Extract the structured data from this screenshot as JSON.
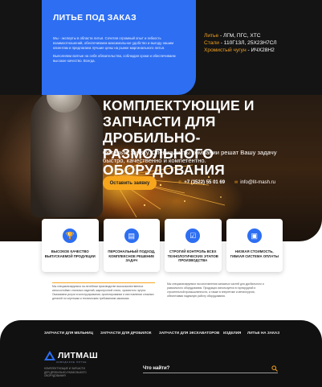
{
  "info_card": {
    "title": "ЛИТЬЕ ПОД ЗАКАЗ",
    "paragraph_1": "Мы - эксперты в области литья. Сочетая огромный опыт и гибкость взаимоотношений, обеспечиваем максимальное удобство и выгоду нашим клиентам и предлагаем лучшие цены на рынке маргинального литья.",
    "paragraph_2": "Выполняем взятые на себя обязательства, соблюдая сроки и обеспечиваем высокое качество. Всегда."
  },
  "materials": [
    {
      "label": "Литье",
      "value": " - ЛГМ, ПГС, ХТС"
    },
    {
      "label": "Стали",
      "value": " - 110Г13Л, 25Х23Н7СЛ"
    },
    {
      "label": "Хромистый чугун",
      "value": " - ИЧХ28Н2"
    }
  ],
  "hero": {
    "headline": "КОМПЛЕКТУЮЩИЕ И ЗАПЧАСТИ ДЛЯ ДРОБИЛЬНО-РАЗМОЛЬНОГО ОБОРУДОВАНИЯ",
    "lead": "Оставьте заявку. Специалисты компании решат Вашу задачу быстро, качественно и компетентно.",
    "cta_label": "Оставить заявку",
    "phone": "+7 (3522) 55 01 69",
    "email": "info@lit-mash.ru"
  },
  "features": [
    {
      "icon": "trophy-icon",
      "label": "ВЫСОКОЕ КАЧЕСТВО ВЫПУСКАЕМОЙ ПРОДУКЦИИ"
    },
    {
      "icon": "document-icon",
      "label": "ПЕРСОНАЛЬНЫЙ ПОДХОД, КОМПЛЕКСНОЕ РЕШЕНИЕ ЗАДАЧ"
    },
    {
      "icon": "clipboard-icon",
      "label": "СТРОГИЙ КОНТРОЛЬ ВСЕХ ТЕХНОЛОГИЧЕСКИХ ЭТАПОВ ПРОИЗВОДСТВА"
    },
    {
      "icon": "wallet-icon",
      "label": "НИЗКАЯ СТОИМОСТЬ, ГИБКАЯ СИСТЕМА ОПЛАТЫ"
    }
  ],
  "descriptions": {
    "left": "Мы специализируемся на литейном производстве высококачественных износостойких стальных изделий, жаропрочной стали, хромистого чугуна. Оказываем услуги в конструировании, проектировании и изготовлении сложных деталей по чертежам и техническим требованиям заказчика.",
    "right": "Мы специализируемся на изготовлении запасных частей для дробильного и размольного оборудования. Продукция используется в горнорудной и строительной промышленности, а также в энергетике и металлургии, обеспечивая надежную работу оборудования."
  },
  "footer": {
    "nav": [
      "ЗАПЧАСТИ ДЛЯ МЕЛЬНИЦ",
      "ЗАПЧАСТИ ДЛЯ ДРОБИЛОК",
      "ЗАПЧАСТИ ДЛЯ ЭКСКАВАТОРОВ",
      "ИЗДЕЛИЯ",
      "ЛИТЬЕ НА ЗАКАЗ"
    ],
    "logo_text": "ЛИТМАШ",
    "logo_sub": "ЗАВОДСКОЕ ЛИТЬЕ",
    "company_desc": "КОМПЛЕКТУЮЩИЕ И ЗАПЧАСТИ ДЛЯ ДРОБИЛЬНО-РАЗМОЛЬНОГО ОБОРУДОВАНИЯ",
    "search_label": "Что найти?"
  },
  "colors": {
    "accent_blue": "#2d6ef2",
    "accent_orange": "#f7a51c",
    "footer_bg": "#111111"
  }
}
